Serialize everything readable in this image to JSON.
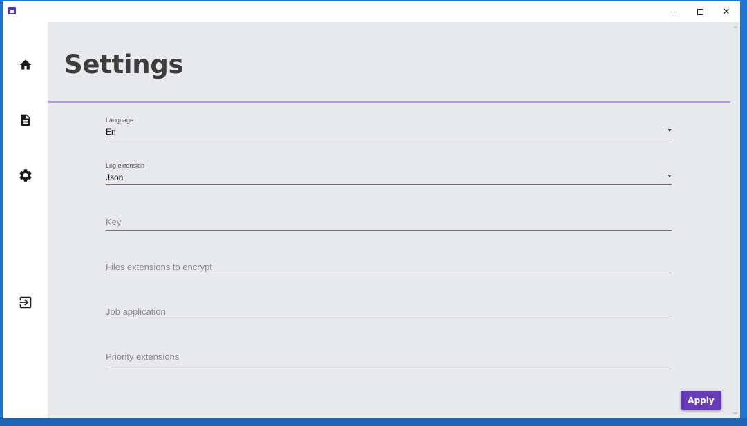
{
  "window": {
    "icon": "app-icon",
    "controls": {
      "minimize_icon": "minimize-icon",
      "maximize_icon": "maximize-icon",
      "close_icon": "close-icon",
      "close_glyph": "✕"
    }
  },
  "sidebar": {
    "items": [
      {
        "icon": "home-icon"
      },
      {
        "icon": "document-icon"
      },
      {
        "icon": "gear-icon"
      },
      {
        "icon": "exit-icon"
      }
    ]
  },
  "page": {
    "title": "Settings",
    "accent_color": "#b39ddb"
  },
  "form": {
    "language": {
      "label": "Language",
      "value": "En"
    },
    "log_extension": {
      "label": "Log extension",
      "value": "Json"
    },
    "key": {
      "placeholder": "Key",
      "value": ""
    },
    "files_extensions": {
      "placeholder": "Files extensions to encrypt",
      "value": ""
    },
    "job_application": {
      "placeholder": "Job application",
      "value": ""
    },
    "priority_extensions": {
      "placeholder": "Priority extensions",
      "value": ""
    }
  },
  "actions": {
    "apply_label": "Apply",
    "apply_color": "#673ab7"
  }
}
